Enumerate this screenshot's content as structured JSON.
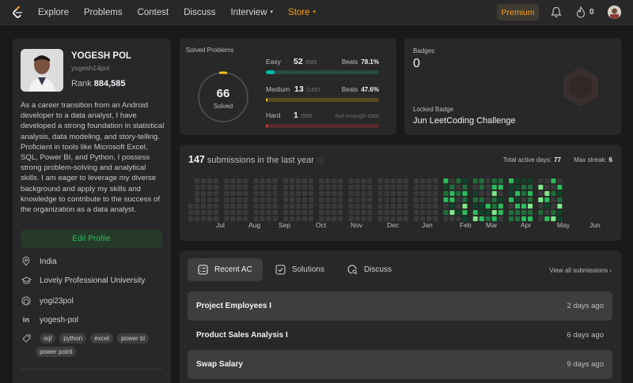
{
  "nav": {
    "links": [
      {
        "label": "Explore"
      },
      {
        "label": "Problems"
      },
      {
        "label": "Contest"
      },
      {
        "label": "Discuss"
      },
      {
        "label": "Interview",
        "caret": "▾"
      },
      {
        "label": "Store",
        "caret": "▾"
      }
    ],
    "premium": "Premium",
    "streak_count": "0",
    "colors": {
      "accent": "#ffa116",
      "bg": "#282828"
    }
  },
  "profile": {
    "name": "YOGESH POL",
    "handle": "yogesh14pol",
    "rank_label": "Rank",
    "rank_value": "884,585",
    "bio": "As a career transition from an Android developer to a data analyst, I have developed a strong foundation in statistical analysis, data modeling, and story-telling. Proficient in tools like Microsoft Excel, SQL, Power BI, and Python, I possess strong problem-solving and analytical skills. I am eager to leverage my diverse background and apply my skills and knowledge to contribute to the success of the organization as a data analyst.",
    "edit_label": "Edit Profile",
    "location": "India",
    "university": "Lovely Professional University",
    "github": "yogi23pol",
    "linkedin": "yogesh-pol",
    "skills": [
      "sql",
      "python",
      "excel",
      "power bi",
      "power point"
    ],
    "icons": [
      "location-icon",
      "graduation-cap-icon",
      "github-icon",
      "linkedin-icon",
      "tag-icon"
    ]
  },
  "solved": {
    "title": "Solved Problems",
    "total": "66",
    "total_label": "Solved",
    "easy": {
      "label": "Easy",
      "solved": 52,
      "total": "/689",
      "beats_label": "Beats",
      "beats": "78.1%",
      "color": "#00b8a3",
      "track": "#2a4a44"
    },
    "medium": {
      "label": "Medium",
      "solved": 13,
      "total": "/1457",
      "beats_label": "Beats",
      "beats": "47.6%",
      "color": "#ffc01e",
      "track": "#5a4a20"
    },
    "hard": {
      "label": "Hard",
      "solved": 1,
      "total": "/605",
      "note": "Not enough data",
      "color": "#ef4743",
      "track": "#5a2a2a"
    }
  },
  "badges": {
    "title": "Badges",
    "count": "0",
    "locked_label": "Locked Badge",
    "locked_name": "Jun LeetCoding Challenge"
  },
  "submissions": {
    "count": "147",
    "label": "submissions in the last year",
    "active_days_label": "Total active days:",
    "active_days": "77",
    "max_streak_label": "Max streak:",
    "max_streak": "6",
    "months": [
      "Jul",
      "Aug",
      "Sep",
      "Oct",
      "Nov",
      "Dec",
      "Jan",
      "Feb",
      "Mar",
      "Apr",
      "May",
      "Jun"
    ],
    "colors": {
      "empty": "#3a3a3a",
      "low": "#0e4429",
      "mid": "#1f6f3a",
      "high": "#2cbb5d",
      "top": "#7ee787"
    }
  },
  "activity": {
    "tabs": [
      {
        "label": "Recent AC",
        "icon": "list-icon"
      },
      {
        "label": "Solutions",
        "icon": "checkbox-icon"
      },
      {
        "label": "Discuss",
        "icon": "discuss-icon"
      }
    ],
    "view_all": "View all submissions",
    "rows": [
      {
        "title": "Project Employees I",
        "time": "2 days ago"
      },
      {
        "title": "Product Sales Analysis I",
        "time": "6 days ago"
      },
      {
        "title": "Swap Salary",
        "time": "9 days ago"
      }
    ]
  }
}
